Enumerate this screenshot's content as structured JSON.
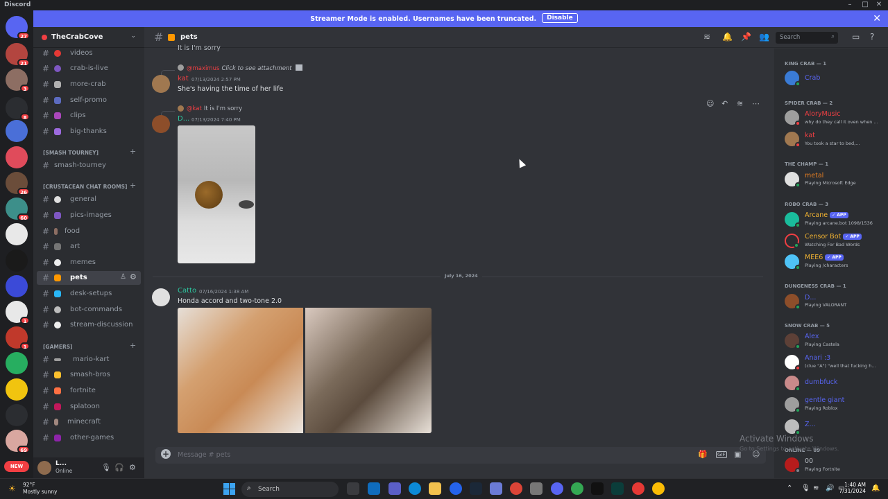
{
  "window": {
    "title": "Discord"
  },
  "banner": {
    "message": "Streamer Mode is enabled. Usernames have been truncated.",
    "button": "Disable"
  },
  "server": {
    "name": "TheCrabCove"
  },
  "guild_badges": [
    "27",
    "21",
    "3",
    "8",
    "26",
    "60",
    "1",
    "1",
    "1",
    "69"
  ],
  "categories": {
    "smash": "[SMASH TOURNEY]",
    "crustacean": "[CRUSTACEAN CHAT ROOMS]",
    "gamers": "[GAMERS]"
  },
  "channels": [
    "videos",
    "crab-is-live",
    "more-crab",
    "self-promo",
    "clips",
    "big-thanks",
    "smash-tourney",
    "general",
    "pics-images",
    "food",
    "art",
    "memes",
    "pets",
    "desk-setups",
    "bot-commands",
    "stream-discussion",
    "mario-kart",
    "smash-bros",
    "fortnite",
    "splatoon",
    "minecraft",
    "other-games"
  ],
  "user_panel": {
    "name": "L...",
    "status": "Online"
  },
  "channel_header": {
    "name": "pets",
    "search_placeholder": "Search"
  },
  "messages": {
    "partial_top": "It is I'm sorry",
    "m1": {
      "reply_author": "@maximus",
      "reply_text": "Click to see attachment",
      "author": "kat",
      "timestamp": "07/13/2024 2:57 PM",
      "text": "She's having the time of her life"
    },
    "m2": {
      "reply_author": "@kat",
      "reply_text": "It is I'm sorry",
      "author": "D...",
      "timestamp": "07/13/2024 7:40 PM"
    },
    "divider": "July 16, 2024",
    "m3": {
      "author": "Catto",
      "timestamp": "07/16/2024 1:38 AM",
      "text": "Honda accord and two-tone 2.0"
    }
  },
  "composer": {
    "placeholder": "Message # pets"
  },
  "members": {
    "cats": {
      "king": "KING CRAB — 1",
      "spider": "SPIDER CRAB — 2",
      "champ": "THE CHAMP — 1",
      "robo": "ROBO CRAB — 3",
      "dungeness": "DUNGENESS CRAB — 1",
      "snow": "SNOW CRAB — 5",
      "online": "ONLINE — 89"
    },
    "list": [
      {
        "name": "Crab",
        "activity": "",
        "color": "#5865f2"
      },
      {
        "name": "AloryMusic",
        "activity": "why do they call it oven when ...",
        "color": "#f23f43"
      },
      {
        "name": "kat",
        "activity": "You took a star to bed,...",
        "color": "#f23f43"
      },
      {
        "name": "metal",
        "activity": "Playing Microsoft Edge",
        "color": "#e67e22"
      },
      {
        "name": "Arcane",
        "activity": "Playing arcane.bot 1098/1536",
        "color": "#f0b232"
      },
      {
        "name": "Censor Bot",
        "activity": "Watching For Bad Words",
        "color": "#f0b232"
      },
      {
        "name": "MEE6",
        "activity": "Playing /characters",
        "color": "#f0b232"
      },
      {
        "name": "D...",
        "activity": "Playing VALORANT",
        "color": "#5865f2"
      },
      {
        "name": "Alex",
        "activity": "Playing Castela",
        "color": "#5865f2"
      },
      {
        "name": "Anari :3",
        "activity": "(clue \"A\") \"well that fucking h...",
        "color": "#5865f2"
      },
      {
        "name": "dumbfuck",
        "activity": "",
        "color": "#5865f2"
      },
      {
        "name": "gentle giant",
        "activity": "Playing Roblox",
        "color": "#5865f2"
      },
      {
        "name": "Z...",
        "activity": "",
        "color": "#5865f2"
      },
      {
        "name": "00",
        "activity": "Playing Fortnite",
        "color": "#b5bac1"
      }
    ],
    "app_tag": "✓ APP"
  },
  "watermark": {
    "line1": "Activate Windows",
    "line2": "Go to Settings to activate Windows."
  },
  "taskbar": {
    "temp": "92°F",
    "condition": "Mostly sunny",
    "search": "Search",
    "time": "1:40 AM",
    "date": "7/31/2024"
  },
  "colors": {
    "blurple": "#5865f2",
    "bg": "#313338",
    "sidebar": "#2b2d31"
  }
}
